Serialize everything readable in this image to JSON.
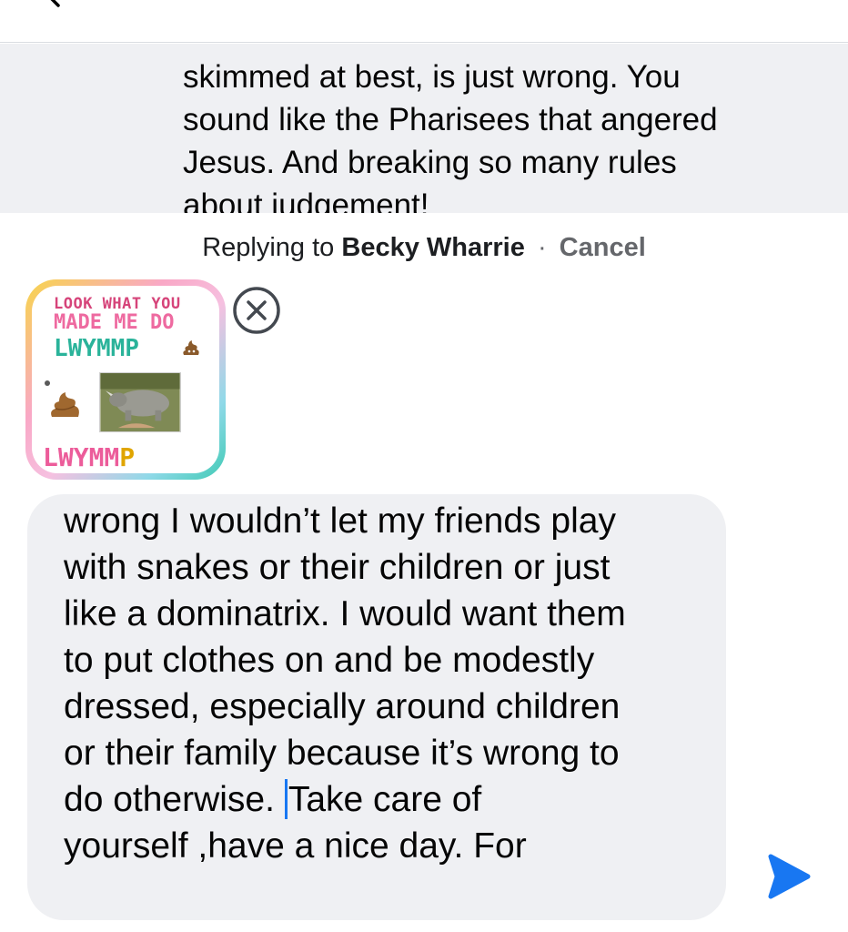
{
  "comment": {
    "lines": [
      "skimmed at best, is just wrong. You",
      "sound like the Pharisees that angered",
      "Jesus. And breaking so many rules",
      "about judgement!"
    ]
  },
  "reply": {
    "prefix": "Replying to",
    "name": "Becky Wharrie",
    "separator": "·",
    "cancel_label": "Cancel"
  },
  "sticker": {
    "line1": "LOOK WHAT YOU",
    "line2": "MADE ME DO",
    "line3": "LWYMMP",
    "line4_main": "LWYMM",
    "line4_end": "P"
  },
  "input": {
    "lines_before_caret": [
      "wrong I wouldn’t let my friends play",
      "with snakes or their children or just",
      "like a dominatrix. I would want them",
      "to put clothes on and be modestly",
      "dressed, especially around children",
      "or their family because it’s wrong to"
    ],
    "caret_line_before": "do otherwise. ",
    "caret_line_after": "Take care of",
    "lines_after_caret": [
      "yourself ,have a nice day. For"
    ]
  },
  "icons": {
    "back": "chevron-left-icon",
    "remove": "close-circle-icon",
    "send": "send-icon"
  },
  "colors": {
    "accent": "#1877f2",
    "bubble": "#eff0f3",
    "secondary_text": "#65676b"
  }
}
